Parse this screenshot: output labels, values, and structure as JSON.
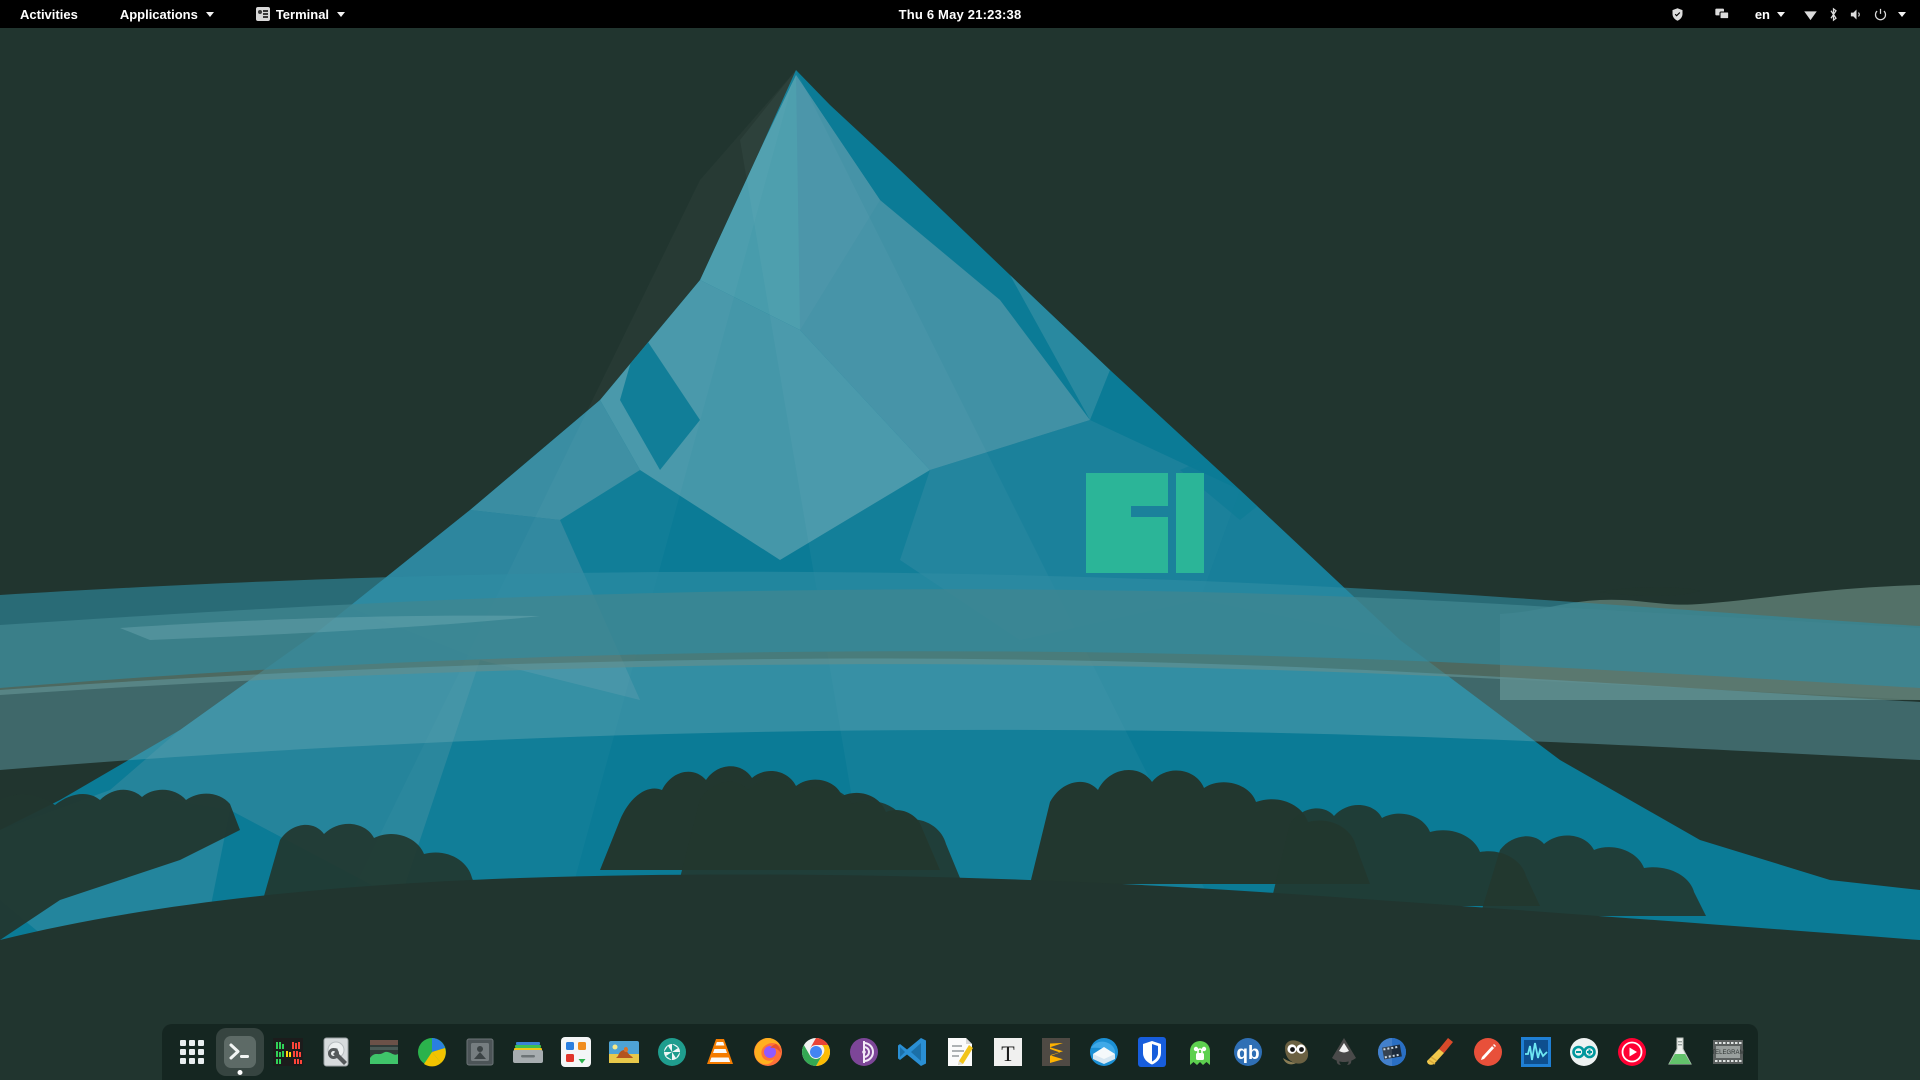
{
  "desktop": {
    "os": "Manjaro Linux",
    "shell": "GNOME",
    "background_color": "#21352f",
    "wallpaper": {
      "name": "manjaro-mountain-wallpaper",
      "logo": "manjaro-logo",
      "logo_color": "#2bb598",
      "sky_color": "#21352f",
      "mountain_color": "#0b7b96",
      "mountain_light_color": "#3d8fa3",
      "mountain_highlight_color": "#4e9eae",
      "mist_color": "#2f8ca3",
      "ridge_color": "#5a7a70",
      "tree_color": "#22372f"
    }
  },
  "topbar": {
    "background": "#000000",
    "activities_label": "Activities",
    "applications_label": "Applications",
    "window_title": "Terminal",
    "clock": "Thu 6 May  21:23:38",
    "tray": {
      "language": "en",
      "items": [
        {
          "name": "shield-icon",
          "label": "Security"
        },
        {
          "name": "screencast-icon",
          "label": "Display"
        },
        {
          "name": "language-indicator",
          "label": "en"
        },
        {
          "name": "wifi-icon",
          "label": "Wi-Fi"
        },
        {
          "name": "bluetooth-icon",
          "label": "Bluetooth"
        },
        {
          "name": "volume-icon",
          "label": "Volume"
        },
        {
          "name": "power-icon",
          "label": "Power"
        },
        {
          "name": "chevron-down-icon",
          "label": "System Menu"
        }
      ]
    }
  },
  "dock": {
    "background": "rgba(12,26,22,0.55)",
    "items": [
      {
        "name": "show-applications-button",
        "label": "Show Applications",
        "icon": "grid-icon",
        "running": false
      },
      {
        "name": "dock-item-terminal",
        "label": "Terminal",
        "icon": "terminal-icon",
        "running": true
      },
      {
        "name": "dock-item-htop",
        "label": "System Monitor (htop)",
        "icon": "htop-icon",
        "running": false
      },
      {
        "name": "dock-item-disks",
        "label": "Disks",
        "icon": "disks-icon",
        "running": false
      },
      {
        "name": "dock-item-system-monitor",
        "label": "System Monitor",
        "icon": "monitor-icon",
        "running": false
      },
      {
        "name": "dock-item-disk-usage",
        "label": "Disk Usage Analyzer",
        "icon": "pie-icon",
        "running": false
      },
      {
        "name": "dock-item-archive-manager",
        "label": "Archive Manager",
        "icon": "archive-icon",
        "running": false
      },
      {
        "name": "dock-item-files",
        "label": "Files",
        "icon": "files-icon",
        "running": false
      },
      {
        "name": "dock-item-software",
        "label": "Add/Remove Software",
        "icon": "software-icon",
        "running": false
      },
      {
        "name": "dock-item-image-viewer",
        "label": "Image Viewer",
        "icon": "image-icon",
        "running": false
      },
      {
        "name": "dock-item-shotwell",
        "label": "Shotwell",
        "icon": "shotwell-icon",
        "running": false
      },
      {
        "name": "dock-item-vlc",
        "label": "VLC media player",
        "icon": "vlc-icon",
        "running": false
      },
      {
        "name": "dock-item-firefox",
        "label": "Firefox",
        "icon": "firefox-icon",
        "running": false
      },
      {
        "name": "dock-item-chrome",
        "label": "Google Chrome",
        "icon": "chrome-icon",
        "running": false
      },
      {
        "name": "dock-item-tor-browser",
        "label": "Tor Browser",
        "icon": "tor-icon",
        "running": false
      },
      {
        "name": "dock-item-vscode",
        "label": "Visual Studio Code",
        "icon": "vscode-icon",
        "running": false
      },
      {
        "name": "dock-item-text-editor",
        "label": "Text Editor",
        "icon": "gedit-icon",
        "running": false
      },
      {
        "name": "dock-item-texmaker",
        "label": "Texmaker",
        "icon": "texmaker-icon",
        "running": false
      },
      {
        "name": "dock-item-sublime-text",
        "label": "Sublime Text",
        "icon": "sublime-icon",
        "running": false
      },
      {
        "name": "dock-item-thunderbird",
        "label": "Thunderbird Mail",
        "icon": "thunderbird-icon",
        "running": false
      },
      {
        "name": "dock-item-bitwarden",
        "label": "Bitwarden",
        "icon": "bitwarden-icon",
        "running": false
      },
      {
        "name": "dock-item-pia-vpn",
        "label": "Private Internet Access",
        "icon": "pia-icon",
        "running": false
      },
      {
        "name": "dock-item-qbittorrent",
        "label": "qBittorrent",
        "icon": "qbittorrent-icon",
        "running": false
      },
      {
        "name": "dock-item-gimp",
        "label": "GNU Image Manipulation Program",
        "icon": "gimp-icon",
        "running": false
      },
      {
        "name": "dock-item-inkscape",
        "label": "Inkscape",
        "icon": "inkscape-icon",
        "running": false
      },
      {
        "name": "dock-item-video-editor",
        "label": "Video Editor",
        "icon": "film-icon",
        "running": false
      },
      {
        "name": "dock-item-bleachbit",
        "label": "BleachBit",
        "icon": "broom-icon",
        "running": false
      },
      {
        "name": "dock-item-syringe-app",
        "label": "Flameshot",
        "icon": "needle-icon",
        "running": false
      },
      {
        "name": "dock-item-audio-editor",
        "label": "Audio Editor",
        "icon": "waveform-icon",
        "running": false
      },
      {
        "name": "dock-item-arduino",
        "label": "Arduino IDE",
        "icon": "arduino-icon",
        "running": false
      },
      {
        "name": "dock-item-youtube-music",
        "label": "YouTube Music",
        "icon": "youtube-music-icon",
        "running": false
      },
      {
        "name": "dock-item-lab-app",
        "label": "Octave",
        "icon": "flask-icon",
        "running": false
      },
      {
        "name": "dock-item-telegram",
        "label": "Telegram",
        "icon": "filmstrip-icon",
        "running": false
      }
    ]
  }
}
